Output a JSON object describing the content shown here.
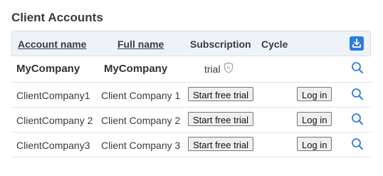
{
  "page": {
    "title": "Client Accounts"
  },
  "table": {
    "columns": {
      "account_name": "Account name",
      "full_name": "Full name",
      "subscription": "Subscription",
      "cycle": "Cycle"
    },
    "download_icon": "download-icon",
    "rows": [
      {
        "account": "MyCompany",
        "full_name": "MyCompany",
        "subscription": "trial",
        "badge_icon": "shield-r-icon"
      },
      {
        "account": "ClientCompany1",
        "full_name": "Client Company 1",
        "trial_button": "Start free trial",
        "login_button": "Log in"
      },
      {
        "account": "ClientCompany 2",
        "full_name": "Client Company 2",
        "trial_button": "Start free trial",
        "login_button": "Log in"
      },
      {
        "account": "ClientCompany3",
        "full_name": "Client Company 3",
        "trial_button": "Start free trial",
        "login_button": "Log in"
      }
    ]
  },
  "colors": {
    "accent": "#2c7be5",
    "header_bg": "#eef3f9"
  }
}
